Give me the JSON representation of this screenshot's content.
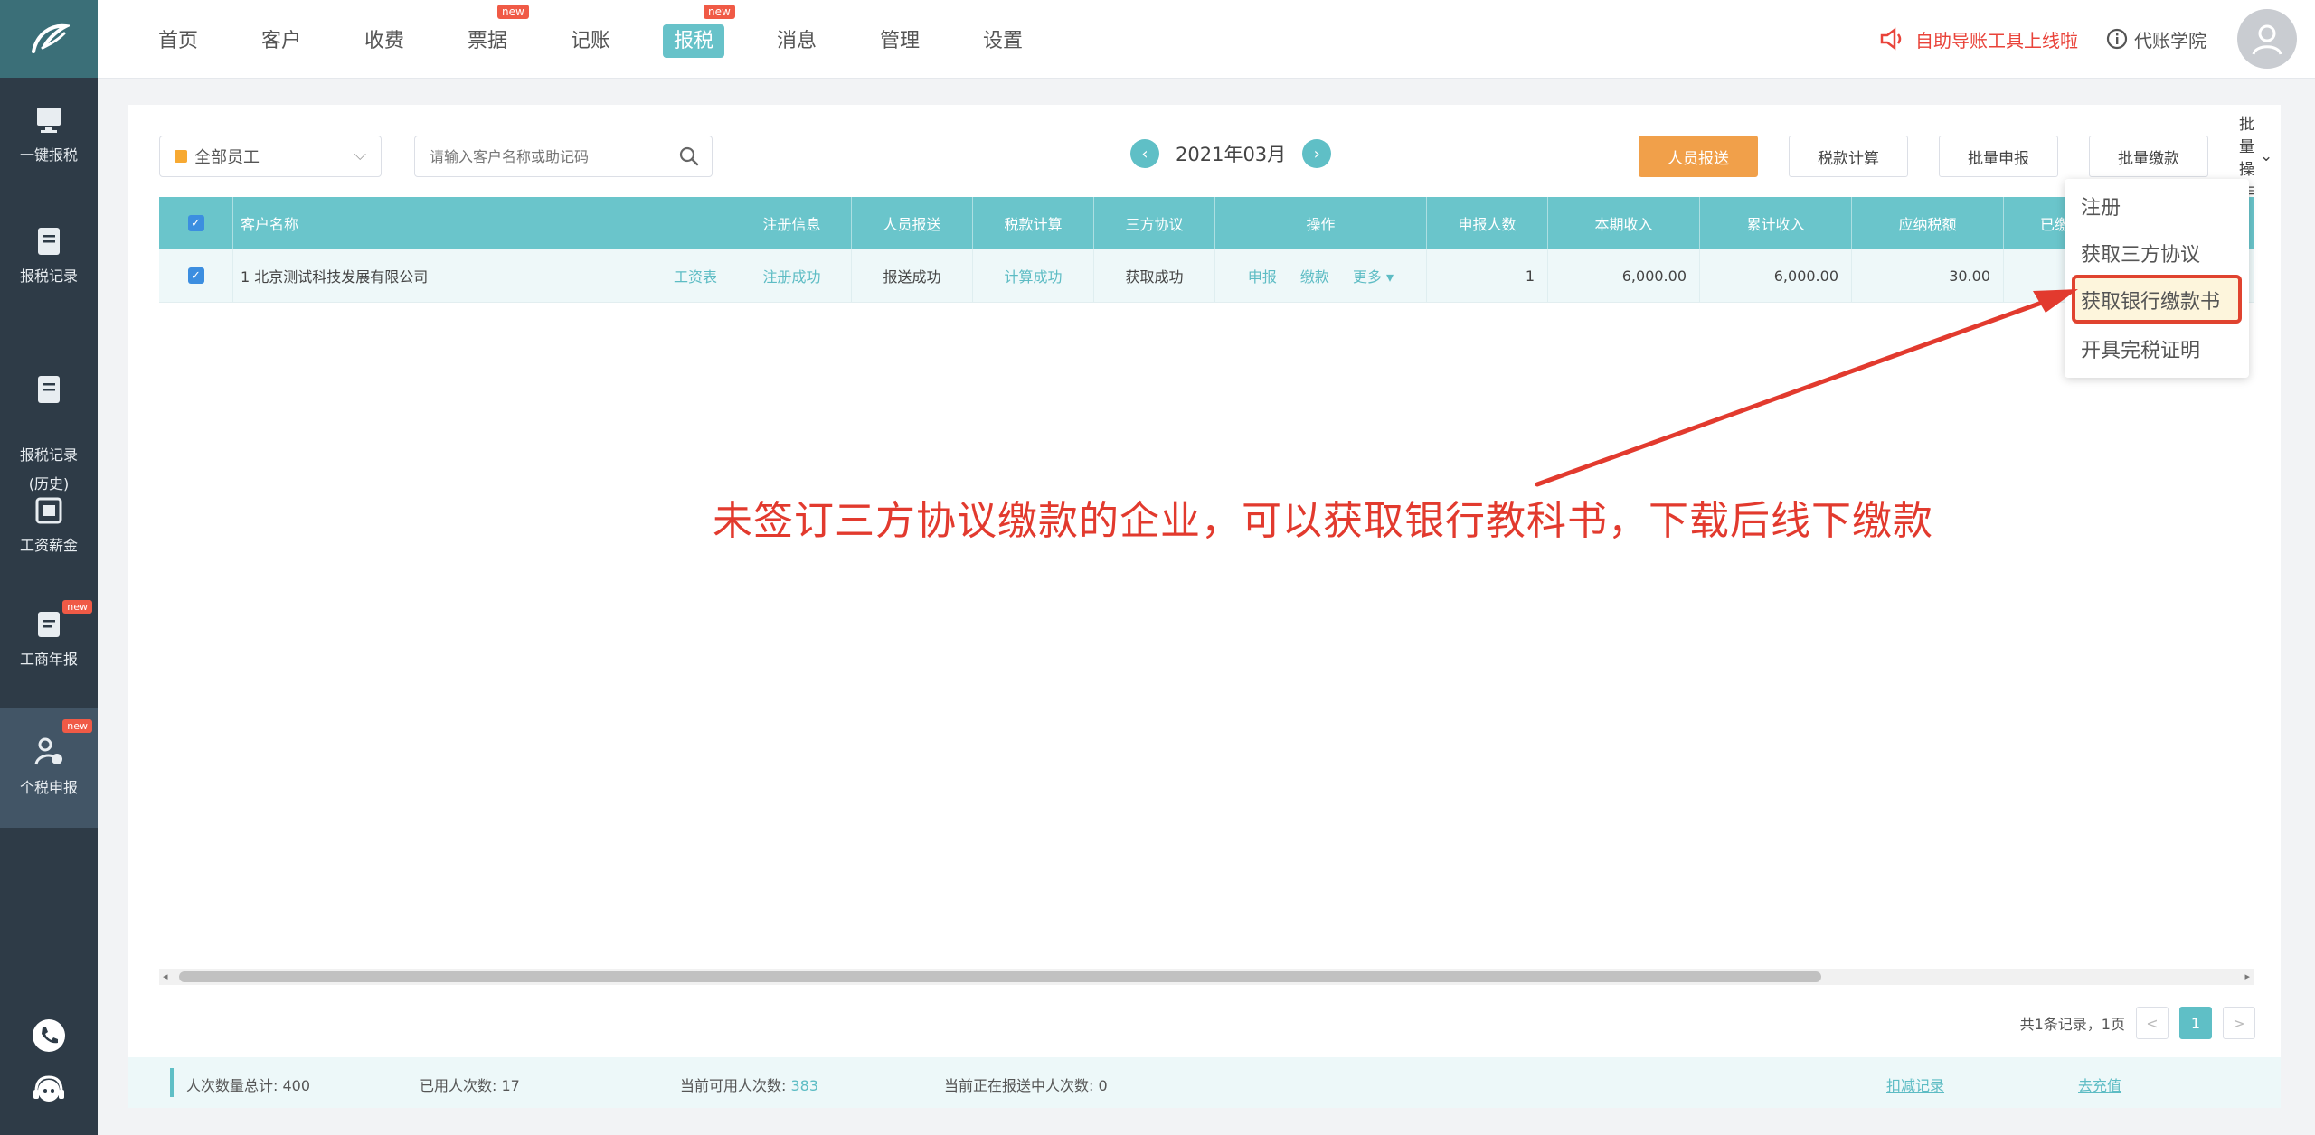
{
  "topbar": {
    "nav": [
      {
        "label": "首页",
        "new": false
      },
      {
        "label": "客户",
        "new": false
      },
      {
        "label": "收费",
        "new": false
      },
      {
        "label": "票据",
        "new": true
      },
      {
        "label": "记账",
        "new": false
      },
      {
        "label": "报税",
        "new": true,
        "active": true
      },
      {
        "label": "消息",
        "new": false
      },
      {
        "label": "管理",
        "new": false
      },
      {
        "label": "设置",
        "new": false
      }
    ],
    "new_badge": "new",
    "tool_link": "自助导账工具上线啦",
    "academy": "代账学院"
  },
  "sidebar": {
    "items": [
      {
        "label": "一键报税",
        "new": false
      },
      {
        "label": "报税记录",
        "new": false
      },
      {
        "label": "报税记录\n(历史)",
        "new": false
      },
      {
        "label": "工资薪金",
        "new": false
      },
      {
        "label": "工商年报",
        "new": true
      },
      {
        "label": "个税申报",
        "new": true,
        "active": true
      }
    ],
    "new_badge": "new"
  },
  "toolbar": {
    "employee_select": "全部员工",
    "search_placeholder": "请输入客户名称或助记码",
    "month": "2021年03月",
    "buttons": [
      "人员报送",
      "税款计算",
      "批量申报",
      "批量缴款"
    ],
    "batch_op": "批量操作"
  },
  "table": {
    "headers": [
      "客户名称",
      "注册信息",
      "人员报送",
      "税款计算",
      "三方协议",
      "操作",
      "申报人数",
      "本期收入",
      "累计收入",
      "应纳税额",
      "已缴"
    ],
    "rows": [
      {
        "customer": "1 北京测试科技发展有限公司",
        "payroll_link": "工资表",
        "register": "注册成功",
        "staff_report": "报送成功",
        "tax_calc": "计算成功",
        "tripartite": "获取成功",
        "ops": [
          "申报",
          "缴款",
          "更多"
        ],
        "declare_count": "1",
        "income_current": "6,000.00",
        "income_total": "6,000.00",
        "tax_due": "30.00"
      }
    ]
  },
  "pager": {
    "summary": "共1条记录，1页",
    "prev": "<",
    "current": "1",
    "next": ">"
  },
  "stats": {
    "total": "人次数量总计: 400",
    "used": "已用人次数: 17",
    "available_label": "当前可用人次数:",
    "available_value": "383",
    "pending": "当前正在报送中人次数: 0",
    "link1": "扣减记录",
    "link2": "去充值"
  },
  "dropdown": {
    "items": [
      "注册",
      "获取三方协议",
      "获取银行缴款书",
      "开具完税证明"
    ],
    "highlighted": 2
  },
  "annotation": "未签订三方协议缴款的企业，可以获取银行教科书，下载后线下缴款",
  "colors": {
    "teal": "#5fbfc6",
    "sidebar": "#2e3b47",
    "annotation": "#e23a2e",
    "orange": "#f1a04a"
  }
}
